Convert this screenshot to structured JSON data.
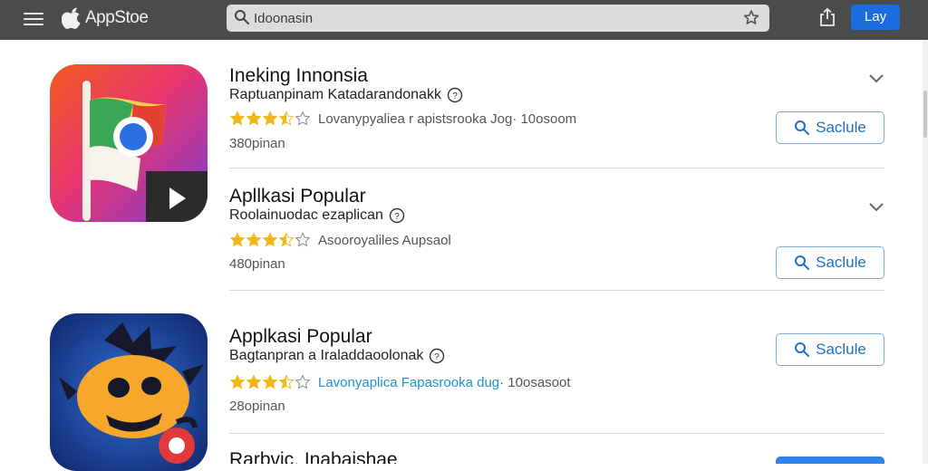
{
  "header": {
    "brand": "AppStoe",
    "search_placeholder": "Idoonasin",
    "button_label": "Lay"
  },
  "apps": [
    {
      "title": "Ineking Innonsia",
      "subtitle": "Raptuanpinam Katadarandonakk",
      "rating_stars": 3.5,
      "rating_text": "Lovanypyaliea r apistsrooka Jog",
      "rating_suffix": " · 10osoom",
      "count": "380pinan",
      "button_label": "Saclule"
    },
    {
      "title": "Apllkasi Popular",
      "subtitle": "Roolainuodac ezaplican",
      "rating_stars": 3.5,
      "rating_text": "Asooroyaliles Aupsaol",
      "rating_suffix": "",
      "count": "480pinan",
      "button_label": "Saclule"
    },
    {
      "title": "Applkasi Popular",
      "subtitle": "Bagtanpran a Iraladdaoolonak",
      "rating_stars": 3.5,
      "rating_text": "Lavonyaplica Fapasrooka dug",
      "rating_suffix": " · 10osasoot",
      "count": "28opinan",
      "button_label": "Saclule"
    },
    {
      "title": "Rarbvic. Inabaishae",
      "subtitle": "",
      "count": "",
      "button_label": ""
    }
  ],
  "colors": {
    "topbar": "#4a4b4d",
    "accent": "#1b6de0",
    "star": "#f2b71c",
    "link": "#1f93c9"
  }
}
